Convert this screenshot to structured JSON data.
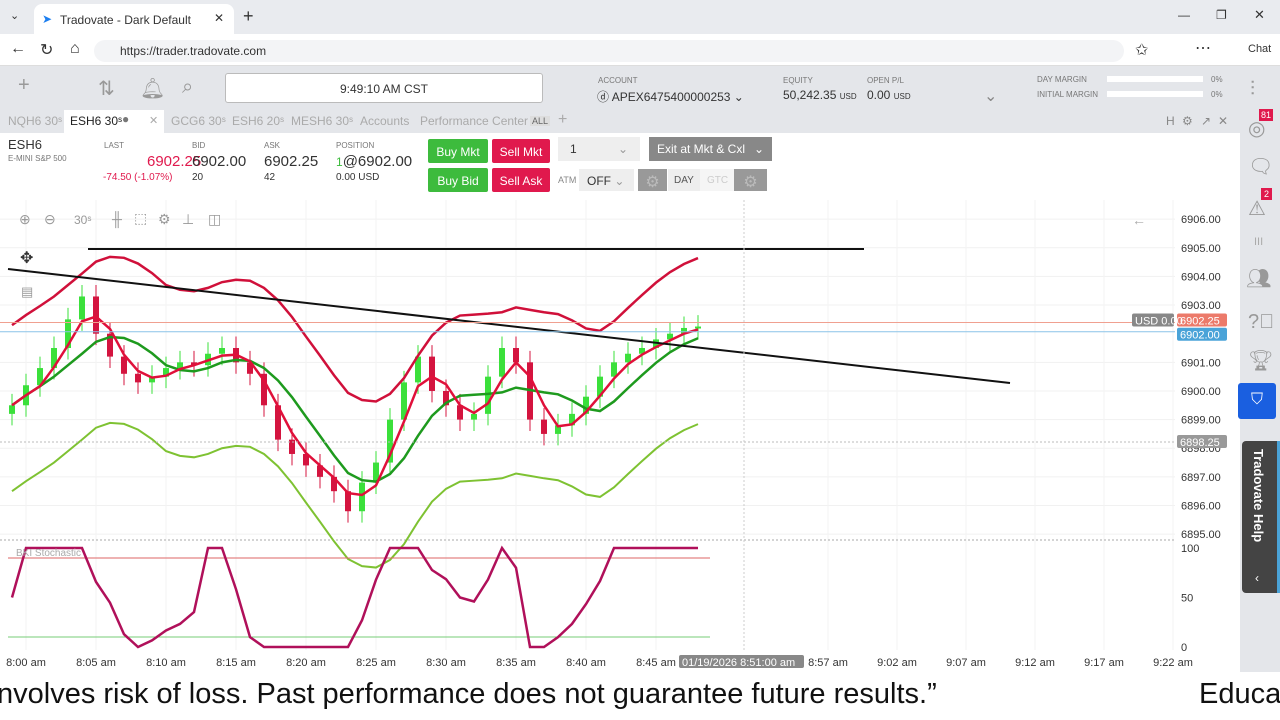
{
  "browser": {
    "tab_title": "Tradovate - Dark Default",
    "url": "https://trader.tradovate.com",
    "chat_label": "Chat"
  },
  "header": {
    "clock": "9:49:10 AM CST",
    "account_label": "ACCOUNT",
    "account": "APEX6475400000253",
    "equity_label": "EQUITY",
    "equity": "50,242.35",
    "equity_ccy": "USD",
    "openpl_label": "OPEN P/L",
    "openpl": "0.00",
    "openpl_ccy": "USD",
    "day_margin_label": "DAY MARGIN",
    "day_margin": "0%",
    "initial_margin_label": "INITIAL MARGIN",
    "initial_margin": "0%"
  },
  "tabs": [
    "NQH6 30ˢ",
    "ESH6 30ˢ",
    "GCG6 30ˢ",
    "ESH6 20ˢ",
    "MESH6 30ˢ",
    "Accounts",
    "Performance Center"
  ],
  "tabs_all": "ALL",
  "tab_controls": "H",
  "quote": {
    "symbol": "ESH6",
    "name": "E-MINI S&P 500",
    "last_label": "LAST",
    "last": "6902.25",
    "change": "-74.50 (-1.07%)",
    "bid_label": "BID",
    "bid": "6902.00",
    "bid_size": "20",
    "ask_label": "ASK",
    "ask": "6902.25",
    "ask_size": "42",
    "position_label": "POSITION",
    "position_qty": "1",
    "position_price": "@6902.00",
    "position_pl": "0.00 USD"
  },
  "order": {
    "buy_mkt": "Buy Mkt",
    "sell_mkt": "Sell Mkt",
    "buy_bid": "Buy Bid",
    "sell_ask": "Sell Ask",
    "qty": "1",
    "exit": "Exit at Mkt & Cxl",
    "atm_label": "ATM",
    "atm": "OFF",
    "day": "DAY",
    "gtc": "GTC"
  },
  "chart_toolbar": {
    "interval": "30ˢ"
  },
  "sidebar": {
    "badge_news": "81",
    "badge_alerts": "2",
    "help": "Tradovate Help"
  },
  "chart_data": {
    "type": "candlestick",
    "price_ticks": [
      "6906.00",
      "6905.00",
      "6904.00",
      "6903.00",
      "6901.00",
      "6900.00",
      "6899.00",
      "6898.00",
      "6897.00",
      "6896.00",
      "6895.00"
    ],
    "ylim": [
      6894.9,
      6906.25
    ],
    "last_tag": "6902.25",
    "bid_tag": "6902.00",
    "cursor_tag": "6898.25",
    "pl_tag": "USD 0.00",
    "stoch_label": "BKI Stochastic",
    "stoch_ticks": [
      "100",
      "50",
      "0"
    ],
    "time_ticks": [
      "8:00 am",
      "8:05 am",
      "8:10 am",
      "8:15 am",
      "8:20 am",
      "8:25 am",
      "8:30 am",
      "8:35 am",
      "8:40 am",
      "8:45 am",
      "8:57 am",
      "9:02 am",
      "9:07 am",
      "9:12 am",
      "9:17 am",
      "9:22 am"
    ],
    "cursor_time": "01/19/2026 8:51:00 am",
    "closes": [
      6899.5,
      6900.2,
      6900.8,
      6901.5,
      6902.5,
      6903.3,
      6902.0,
      6901.2,
      6900.6,
      6900.3,
      6900.5,
      6900.8,
      6901.0,
      6900.9,
      6901.3,
      6901.5,
      6901.0,
      6900.6,
      6899.5,
      6898.3,
      6897.8,
      6897.4,
      6897.0,
      6896.5,
      6895.8,
      6896.8,
      6897.5,
      6899.0,
      6900.3,
      6901.2,
      6900.0,
      6899.5,
      6899.0,
      6899.2,
      6900.5,
      6901.5,
      6901.0,
      6899.0,
      6898.5,
      6898.8,
      6899.2,
      6899.8,
      6900.5,
      6901.0,
      6901.3,
      6901.5,
      6901.8,
      6902.0,
      6902.2,
      6902.25
    ]
  },
  "caption": {
    "text": "nvolves risk of loss. Past performance does not guarantee future results.”",
    "right": "Educa"
  }
}
